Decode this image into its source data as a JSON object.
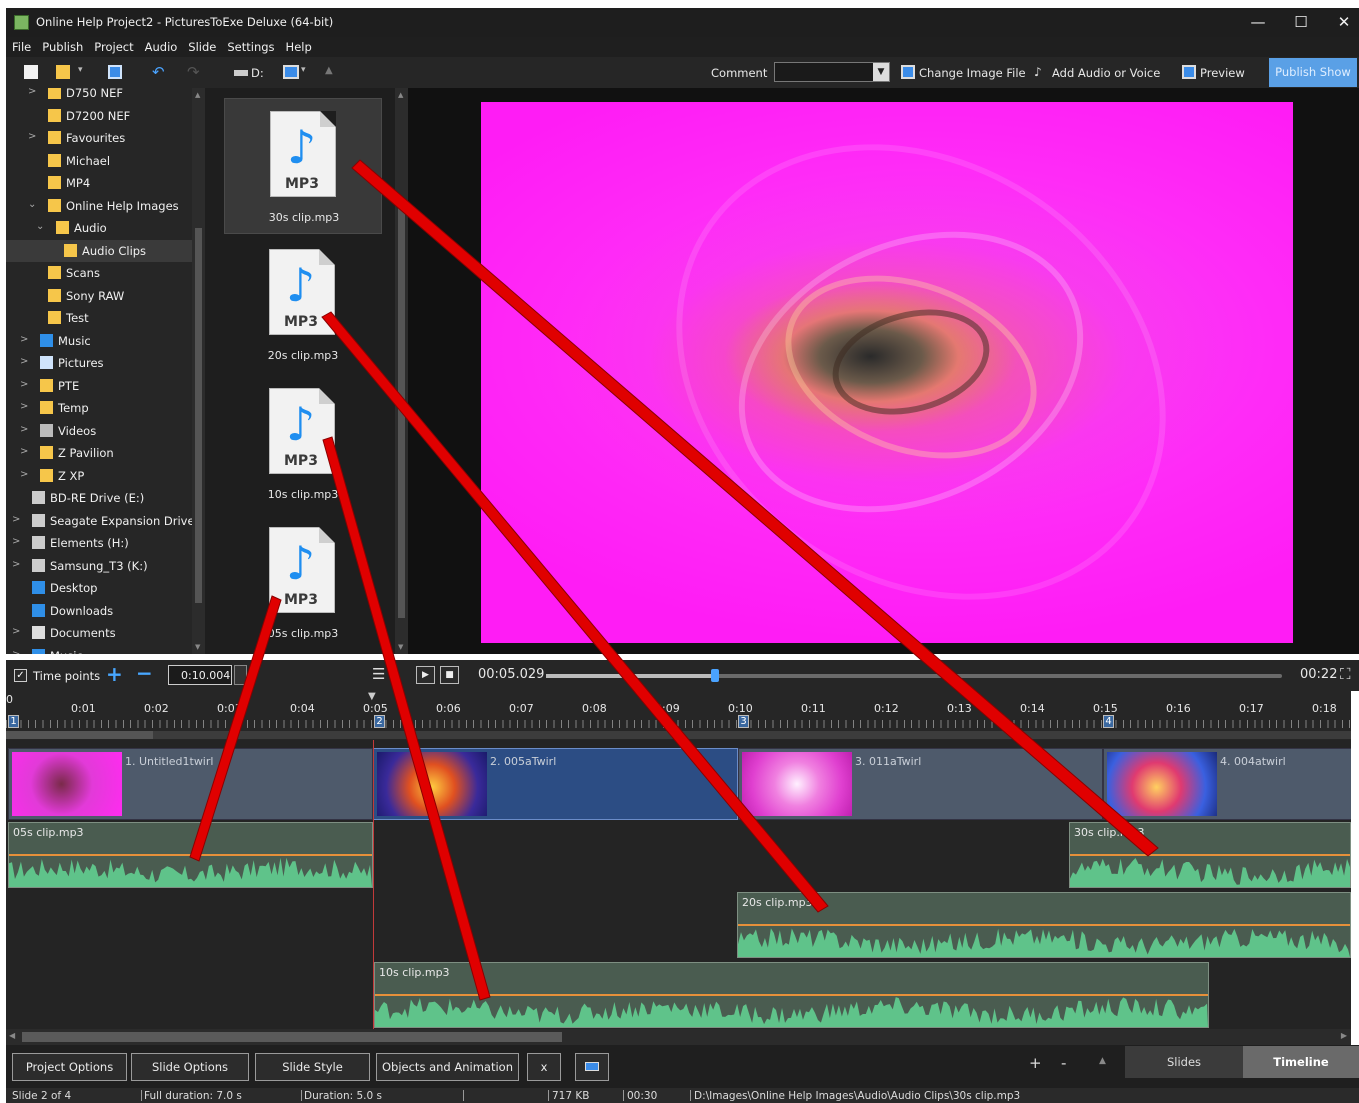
{
  "window": {
    "title": "Online Help Project2 - PicturesToExe Deluxe (64-bit)",
    "controls": [
      "—",
      "☐",
      "✕"
    ]
  },
  "menu": [
    "File",
    "Publish",
    "Project",
    "Audio",
    "Slide",
    "Settings",
    "Help"
  ],
  "toolbar": {
    "drive_label": "D:",
    "comment_label": "Comment",
    "comment_value": "",
    "change_image_label": "Change Image File",
    "add_audio_label": "Add Audio or Voice",
    "preview_label": "Preview",
    "publish_label": "Publish Show"
  },
  "tree": {
    "items": [
      {
        "label": "D750 NEF",
        "icon": "folder-icon",
        "chev": ">"
      },
      {
        "label": "D7200 NEF",
        "icon": "folder-icon",
        "chev": ""
      },
      {
        "label": "Favourites",
        "icon": "folder-icon",
        "chev": ">"
      },
      {
        "label": "Michael",
        "icon": "folder-icon",
        "chev": ""
      },
      {
        "label": "MP4",
        "icon": "folder-icon",
        "chev": ""
      },
      {
        "label": "Online Help Images",
        "icon": "folder-icon",
        "chev": "⌄"
      },
      {
        "label": "Audio",
        "icon": "folder-icon",
        "chev": "⌄"
      },
      {
        "label": "Audio Clips",
        "icon": "folder-icon",
        "chev": "",
        "selected": true
      },
      {
        "label": "Scans",
        "icon": "folder-icon",
        "chev": ""
      },
      {
        "label": "Sony RAW",
        "icon": "folder-icon",
        "chev": ""
      },
      {
        "label": "Test",
        "icon": "folder-icon",
        "chev": ""
      },
      {
        "label": "Music",
        "icon": "music-icon",
        "chev": ">"
      },
      {
        "label": "Pictures",
        "icon": "pictures-icon",
        "chev": ">"
      },
      {
        "label": "PTE",
        "icon": "folder-icon",
        "chev": ">"
      },
      {
        "label": "Temp",
        "icon": "folder-icon",
        "chev": ">"
      },
      {
        "label": "Videos",
        "icon": "videos-icon",
        "chev": ">"
      },
      {
        "label": "Z Pavilion",
        "icon": "folder-icon",
        "chev": ">"
      },
      {
        "label": "Z XP",
        "icon": "folder-icon",
        "chev": ">"
      },
      {
        "label": "BD-RE Drive (E:)",
        "icon": "drive-icon",
        "chev": ""
      },
      {
        "label": "Seagate Expansion Drive...",
        "icon": "drive-icon",
        "chev": ">"
      },
      {
        "label": "Elements (H:)",
        "icon": "drive-icon",
        "chev": ">"
      },
      {
        "label": "Samsung_T3 (K:)",
        "icon": "drive-icon",
        "chev": ">"
      },
      {
        "label": "Desktop",
        "icon": "desktop-icon",
        "chev": ""
      },
      {
        "label": "Downloads",
        "icon": "download-icon",
        "chev": ""
      },
      {
        "label": "Documents",
        "icon": "documents-icon",
        "chev": ">"
      },
      {
        "label": "Music",
        "icon": "music-icon",
        "chev": ">"
      }
    ]
  },
  "files": [
    {
      "name": "30s clip.mp3",
      "ext": "MP3",
      "selected": true
    },
    {
      "name": "20s clip.mp3",
      "ext": "MP3"
    },
    {
      "name": "10s clip.mp3",
      "ext": "MP3"
    },
    {
      "name": "05s clip.mp3",
      "ext": "MP3"
    }
  ],
  "timeline_controls": {
    "time_points_label": "Time points",
    "time_points_checked": true,
    "time_value": "0:10.004",
    "current_time": "00:05.029",
    "total_time": "00:22",
    "seek_fraction": 0.23
  },
  "ruler": {
    "ticks": [
      "0",
      "0:01",
      "0:02",
      "0:03",
      "0:04",
      "0:05",
      "0:06",
      "0:07",
      "0:08",
      "0:09",
      "0:10",
      "0:11",
      "0:12",
      "0:13",
      "0:14",
      "0:15",
      "0:16",
      "0:17",
      "0:18"
    ],
    "markers": [
      "1",
      "2",
      "3",
      "4"
    ]
  },
  "slides": [
    {
      "label": "1. Untitled1twirl"
    },
    {
      "label": "2. 005aTwirl",
      "active": true
    },
    {
      "label": "3. 011aTwirl"
    },
    {
      "label": "4. 004atwirl"
    }
  ],
  "audio_clips": [
    {
      "name": "05s clip.mp3"
    },
    {
      "name": "30s clip.mp3"
    },
    {
      "name": "20s clip.mp3"
    },
    {
      "name": "10s clip.mp3"
    }
  ],
  "bottom_buttons": {
    "project_options": "Project Options",
    "slide_options": "Slide Options",
    "slide_style": "Slide Style",
    "objects_animation": "Objects and Animation",
    "close_x": "x",
    "plus": "+",
    "minus": "-",
    "slides_tab": "Slides",
    "timeline_tab": "Timeline"
  },
  "status": {
    "slide": "Slide 2 of 4",
    "full_duration": "Full duration: 7.0 s",
    "duration": "Duration: 5.0 s",
    "size": "717 KB",
    "time": "00:30",
    "path": "D:\\Images\\Online Help Images\\Audio\\Audio Clips\\30s clip.mp3"
  },
  "colors": {
    "accent": "#5aa0e6",
    "folder": "#f6c64a",
    "arrow": "#e00000",
    "waveform": "#5fc38a",
    "volume_line": "#e6903a"
  }
}
